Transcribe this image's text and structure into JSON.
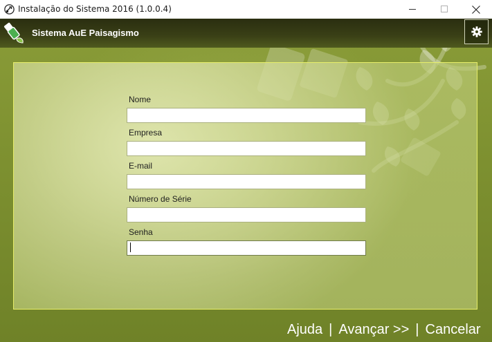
{
  "window": {
    "title": "Instalação do Sistema 2016 (1.0.0.4)"
  },
  "header": {
    "brand_name": "Sistema AuE Paisagismo"
  },
  "form": {
    "fields": [
      {
        "label": "Nome",
        "value": ""
      },
      {
        "label": "Empresa",
        "value": ""
      },
      {
        "label": "E-mail",
        "value": ""
      },
      {
        "label": "Número de Série",
        "value": ""
      },
      {
        "label": "Senha",
        "value": ""
      }
    ]
  },
  "footer": {
    "help_label": "Ajuda",
    "separator": "|",
    "next_label": "Avançar >>",
    "cancel_label": "Cancelar"
  },
  "colors": {
    "header_dark": "#2a2e10",
    "panel_border": "#e8ef6a",
    "background_green": "#7d9030"
  },
  "icons": {
    "app": "usb-drive-app-icon",
    "brand": "usb-leaf-icon",
    "settings": "gear-icon"
  }
}
